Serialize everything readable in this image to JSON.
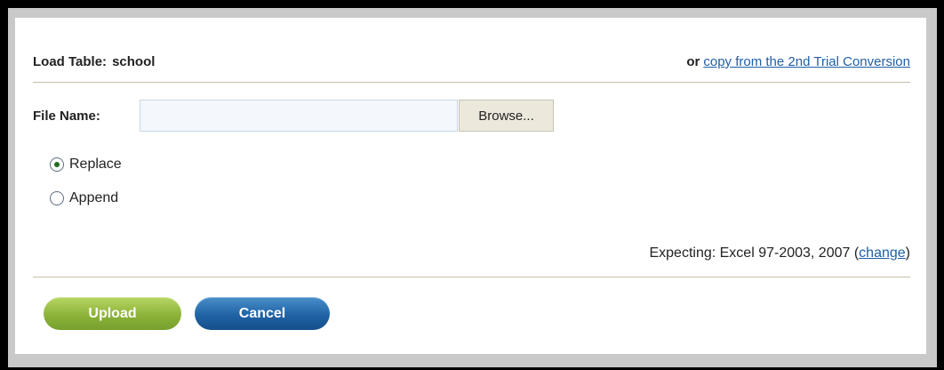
{
  "header": {
    "load_label": "Load Table:",
    "table_name": "school",
    "copy_prefix": "or",
    "copy_link": "copy from the 2nd Trial Conversion"
  },
  "file": {
    "label": "File Name:",
    "value": "",
    "browse_label": "Browse..."
  },
  "mode": {
    "options": [
      {
        "label": "Replace",
        "checked": true
      },
      {
        "label": "Append",
        "checked": false
      }
    ]
  },
  "expecting": {
    "prefix": "Expecting: Excel 97-2003, 2007 (",
    "change_link": "change",
    "suffix": ")"
  },
  "actions": {
    "upload_label": "Upload",
    "cancel_label": "Cancel"
  },
  "colors": {
    "link": "#1f5fa8",
    "upload_button": "#8cb33a",
    "cancel_button": "#1f63a6",
    "divider": "#c7bda7"
  }
}
